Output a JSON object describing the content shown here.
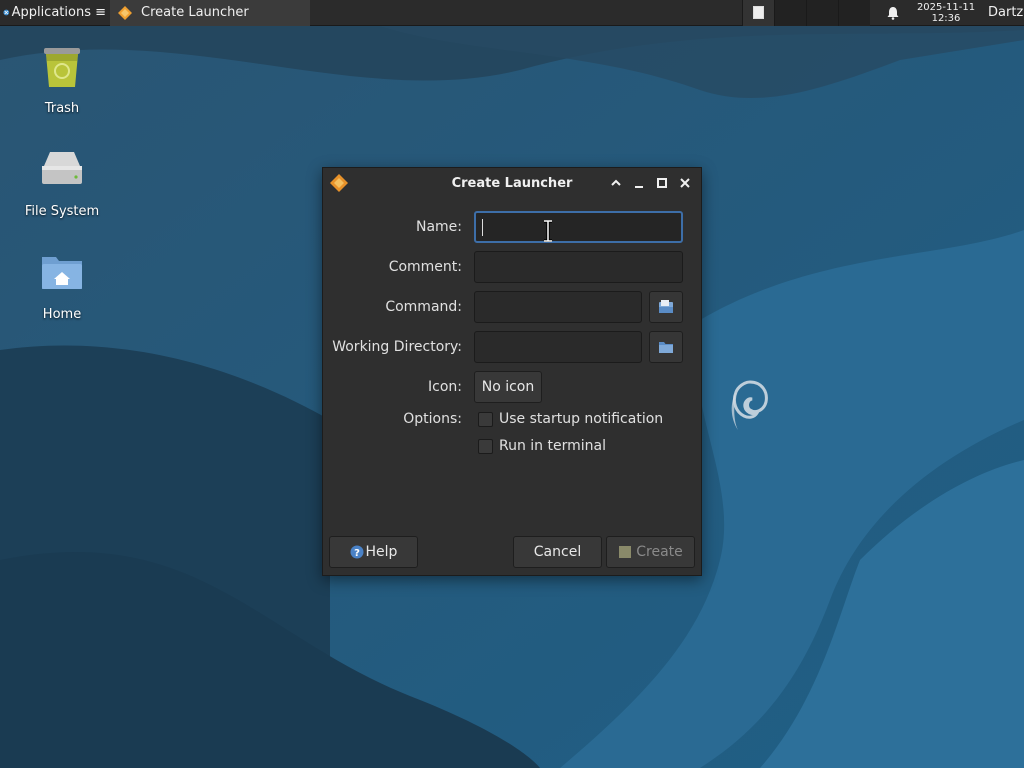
{
  "panel": {
    "applications_label": "Applications ≡",
    "task_title": "Create Launcher",
    "clock_date": "2025-11-11",
    "clock_time": "12:36",
    "user_label": "Dartz"
  },
  "desktop": {
    "icons": [
      {
        "label": "Trash",
        "icon": "trash-icon"
      },
      {
        "label": "File System",
        "icon": "drive-icon"
      },
      {
        "label": "Home",
        "icon": "home-folder-icon"
      }
    ]
  },
  "dialog": {
    "title": "Create Launcher",
    "fields": {
      "name": {
        "label": "Name:",
        "value": ""
      },
      "comment": {
        "label": "Comment:",
        "value": ""
      },
      "command": {
        "label": "Command:",
        "value": ""
      },
      "working_directory": {
        "label": "Working Directory:",
        "value": ""
      },
      "icon": {
        "label": "Icon:",
        "button_label": "No icon"
      }
    },
    "options": {
      "label": "Options:",
      "startup_notification": {
        "label": "Use startup notification",
        "checked": false
      },
      "run_in_terminal": {
        "label": "Run in terminal",
        "checked": false
      }
    },
    "buttons": {
      "help": "Help",
      "cancel": "Cancel",
      "create": "Create"
    }
  },
  "colors": {
    "dialog_bg": "#2f2f2f",
    "panel_bg": "#2b2b2b",
    "focus_border": "#3d6ea8",
    "wallpaper_base": "#1d4e6e"
  }
}
